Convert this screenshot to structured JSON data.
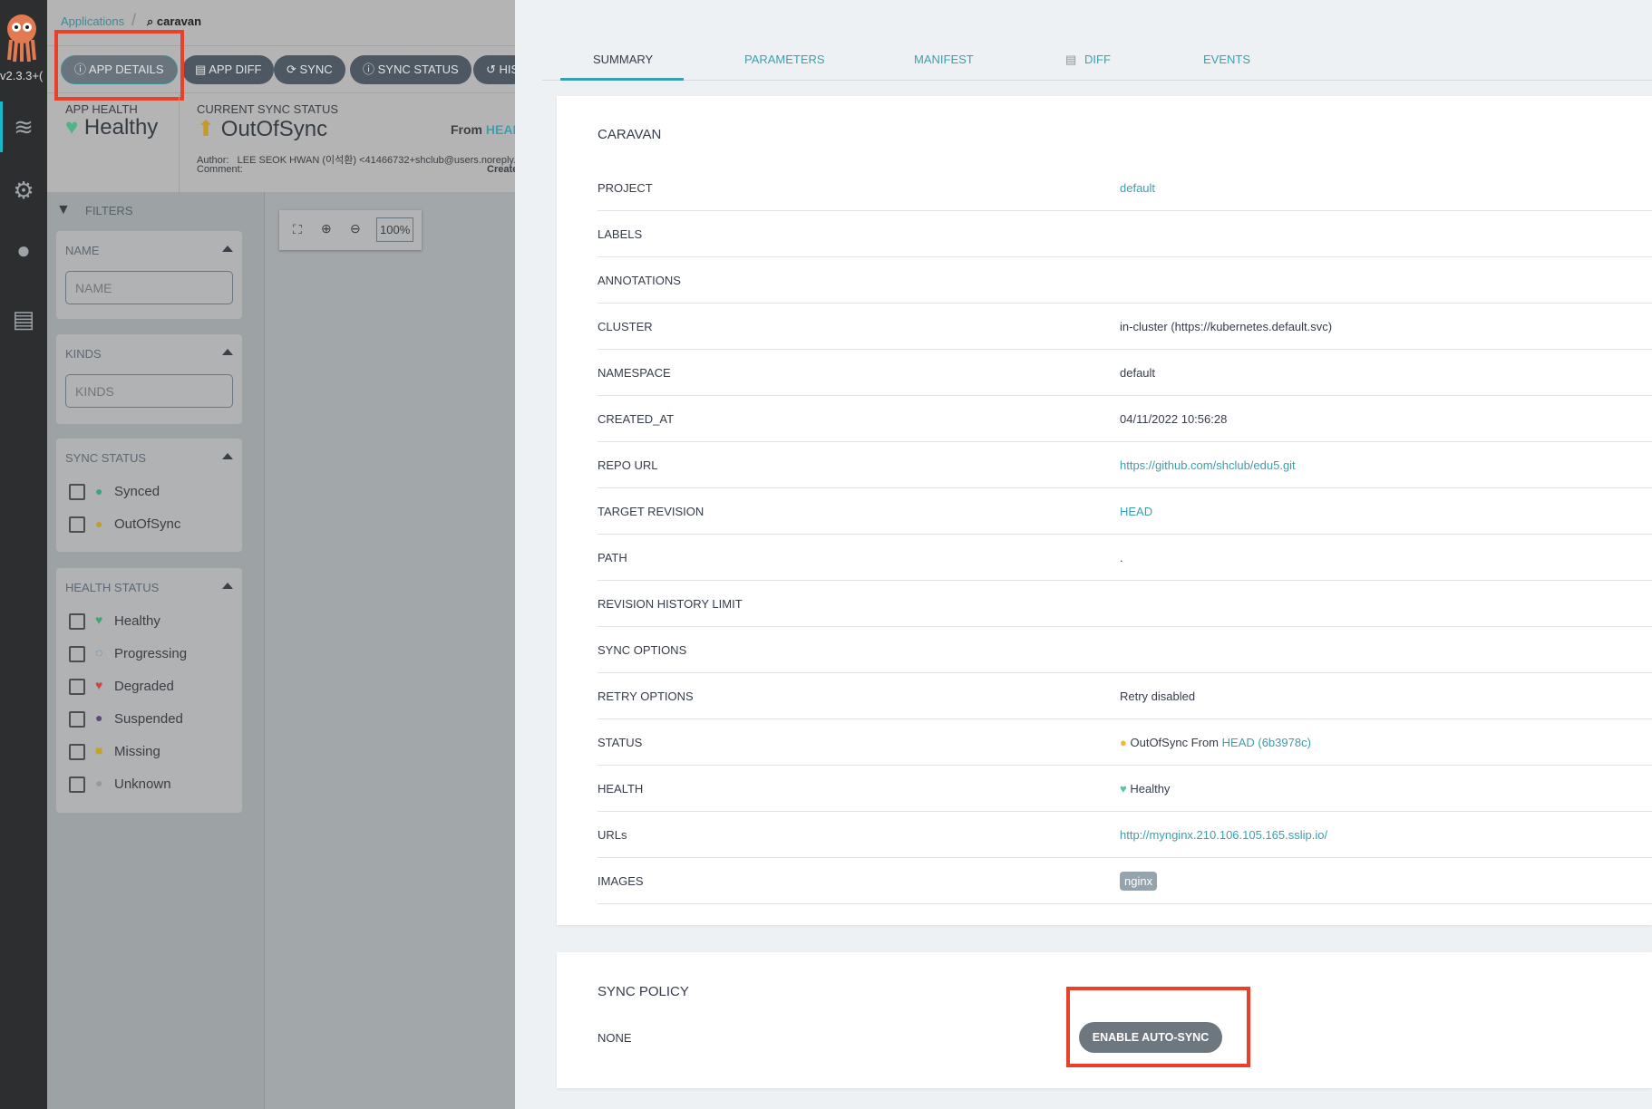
{
  "nav": {
    "version": "v2.3.3+(",
    "icons": [
      "argo-logo",
      "layers-icon",
      "gear-icon",
      "user-icon",
      "docs-icon"
    ]
  },
  "breadcrumb": {
    "root": "Applications",
    "current": "caravan"
  },
  "toolbar": {
    "buttons": [
      "APP DETAILS",
      "APP DIFF",
      "SYNC",
      "SYNC STATUS",
      "HIS"
    ]
  },
  "status": {
    "app_health_label": "APP HEALTH",
    "app_health_value": "Healthy",
    "sync_label": "CURRENT SYNC STATUS",
    "sync_value": "OutOfSync",
    "from_label": "From",
    "from_value": "HEAD",
    "author_label": "Author:",
    "author_value": "LEE SEOK HWAN (이석환) <41466732+shclub@users.noreply.",
    "comment_label": "Comment:",
    "comment_value": "Create"
  },
  "filters": {
    "title": "FILTERS",
    "name": {
      "title": "NAME",
      "placeholder": "NAME"
    },
    "kinds": {
      "title": "KINDS",
      "placeholder": "KINDS"
    },
    "sync_status": {
      "title": "SYNC STATUS",
      "items": [
        "Synced",
        "OutOfSync"
      ]
    },
    "health_status": {
      "title": "HEALTH STATUS",
      "items": [
        "Healthy",
        "Progressing",
        "Degraded",
        "Suspended",
        "Missing",
        "Unknown"
      ]
    }
  },
  "zoom": {
    "level": "100%"
  },
  "tabs": [
    "SUMMARY",
    "PARAMETERS",
    "MANIFEST",
    "DIFF",
    "EVENTS"
  ],
  "summary": {
    "title": "CARAVAN",
    "rows": [
      {
        "key": "PROJECT",
        "value": "default",
        "link": true
      },
      {
        "key": "LABELS",
        "value": ""
      },
      {
        "key": "ANNOTATIONS",
        "value": ""
      },
      {
        "key": "CLUSTER",
        "value": "in-cluster (https://kubernetes.default.svc)"
      },
      {
        "key": "NAMESPACE",
        "value": "default"
      },
      {
        "key": "CREATED_AT",
        "value": "04/11/2022 10:56:28"
      },
      {
        "key": "REPO URL",
        "value": "https://github.com/shclub/edu5.git",
        "link": true
      },
      {
        "key": "TARGET REVISION",
        "value": "HEAD",
        "link": true
      },
      {
        "key": "PATH",
        "value": "."
      },
      {
        "key": "REVISION HISTORY LIMIT",
        "value": ""
      },
      {
        "key": "SYNC OPTIONS",
        "value": ""
      },
      {
        "key": "RETRY OPTIONS",
        "value": "Retry disabled"
      },
      {
        "key": "STATUS",
        "value": "OutOfSync From",
        "extra": "HEAD (6b3978c)"
      },
      {
        "key": "HEALTH",
        "value": "Healthy"
      },
      {
        "key": "URLs",
        "value": "http://mynginx.210.106.105.165.sslip.io/",
        "link": true
      },
      {
        "key": "IMAGES",
        "value": "nginx"
      }
    ]
  },
  "sync_policy": {
    "title": "SYNC POLICY",
    "label": "NONE",
    "button": "ENABLE AUTO-SYNC"
  },
  "colors": {
    "accent": "#3aa0b0",
    "healthy": "#5cc49a",
    "out_of_sync": "#f0b93a",
    "highlight": "#e8402a"
  }
}
